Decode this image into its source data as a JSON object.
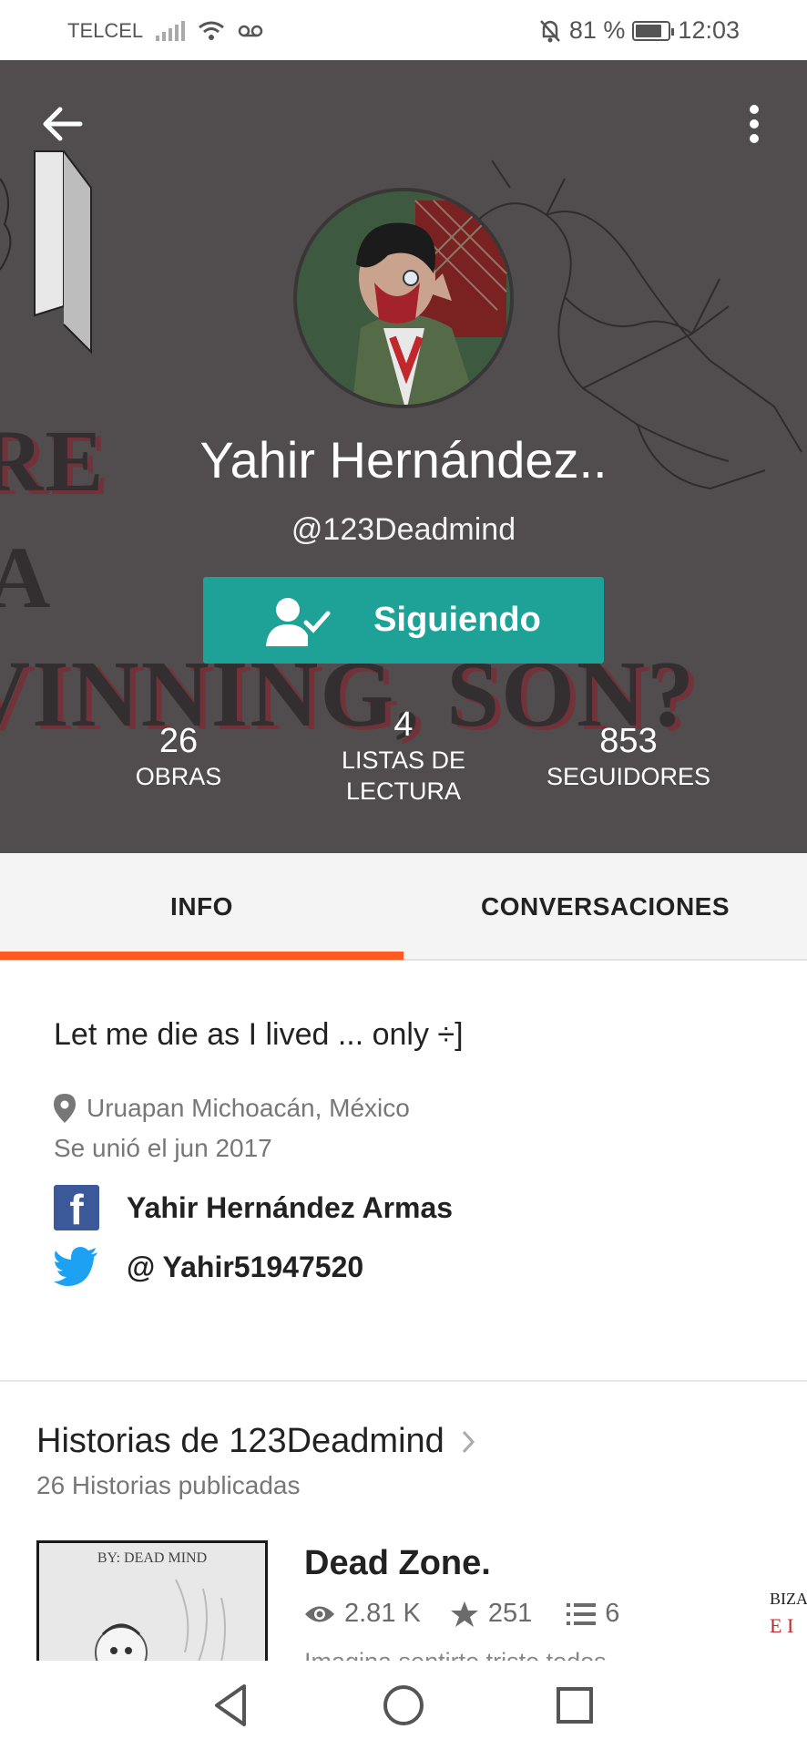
{
  "status_bar": {
    "carrier": "TELCEL",
    "battery": "81 %",
    "battery_level": 0.81,
    "time": "12:03"
  },
  "header": {
    "background_text": [
      "RE",
      "A",
      "VINNING, SON?"
    ],
    "name": "Yahir Hernández..",
    "username": "@123Deadmind",
    "follow_label": "Siguiendo",
    "stats": [
      {
        "value": "26",
        "label": "OBRAS"
      },
      {
        "value": "4",
        "label": "LISTAS DE LECTURA"
      },
      {
        "value": "853",
        "label": "SEGUIDORES"
      }
    ]
  },
  "tabs": [
    {
      "label": "INFO",
      "active": true
    },
    {
      "label": "CONVERSACIONES",
      "active": false
    }
  ],
  "info": {
    "bio": "Let me die as I lived ... only ÷]",
    "location": "Uruapan Michoacán, México",
    "joined": "Se unió el jun 2017",
    "facebook": "Yahir Hernández Armas",
    "twitter": "@ Yahir51947520"
  },
  "stories": {
    "title": "Historias de 123Deadmind",
    "subtitle": "26 Historias publicadas",
    "items": [
      {
        "cover_text": "BY: DEAD MIND",
        "title": "Dead Zone.",
        "reads": "2.81 K",
        "votes": "251",
        "parts": "6",
        "description": "Imagina sentirte triste todos"
      }
    ],
    "next_cover_text": [
      "BIZA",
      "E I"
    ]
  },
  "colors": {
    "accent": "#1ea297",
    "tab_indicator": "#ff5a1f",
    "header_bg": "#514c4e",
    "facebook": "#3b5998",
    "twitter": "#1da1f2"
  }
}
